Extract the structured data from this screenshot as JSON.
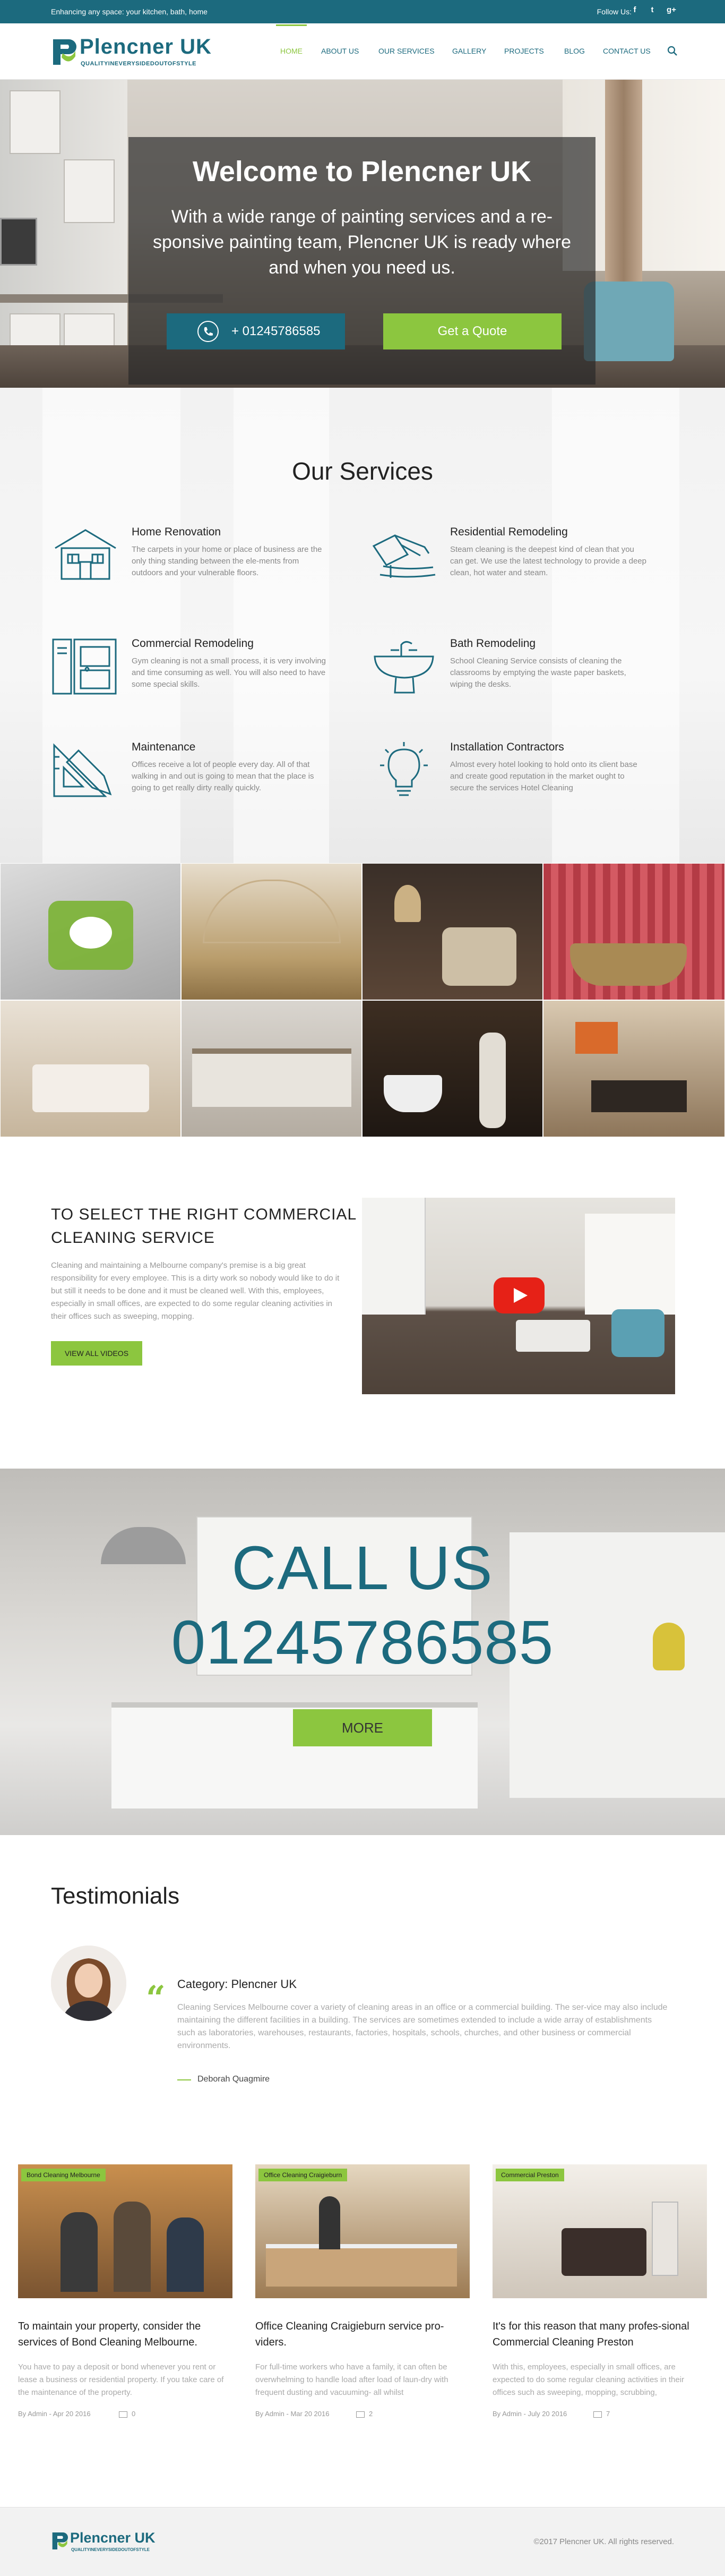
{
  "topbar": {
    "tagline": "Enhancing any space: your kitchen, bath, home",
    "follow_label": "Follow Us:",
    "social": [
      {
        "icon": "facebook-icon",
        "glyph": "f"
      },
      {
        "icon": "twitter-icon",
        "glyph": "t"
      },
      {
        "icon": "google-plus-icon",
        "glyph": "g+"
      }
    ]
  },
  "header": {
    "logo_name": "Plencner UK",
    "logo_sub": "QUALITYINEVERYSIDEDOUTOFSTYLE",
    "nav": [
      "HOME",
      "ABOUT US",
      "OUR SERVICES",
      "GALLERY",
      "PROJECTS",
      "BLOG",
      "CONTACT US"
    ],
    "active_nav": "HOME"
  },
  "hero": {
    "title": "Welcome to Plencner UK",
    "text": "With a wide range of painting services and a re-sponsive painting team, Plencner UK is ready where and when you need us.",
    "phone_button": "+ 01245786585",
    "quote_button": "Get a Quote"
  },
  "services": {
    "title": "Our Services",
    "items": [
      {
        "title": "Home Renovation",
        "icon": "house-icon",
        "desc": "The carpets in your home or place of business are the only thing standing between the ele-ments from outdoors and your vulnerable floors."
      },
      {
        "title": "Residential Remodeling",
        "icon": "paint-roller-icon",
        "desc": "Steam cleaning is the deepest kind of clean that you can get. We use the latest technology to provide a deep clean, hot water and steam."
      },
      {
        "title": "Commercial Remodeling",
        "icon": "door-icon",
        "desc": "Gym cleaning is not a small process, it is very involving and time consuming as well. You will also need to have some special skills."
      },
      {
        "title": "Bath Remodeling",
        "icon": "sink-icon",
        "desc": "School Cleaning Service consists of cleaning the classrooms by emptying the waste paper baskets, wiping the desks."
      },
      {
        "title": "Maintenance",
        "icon": "ruler-pencil-icon",
        "desc": "Offices receive a lot of people every day. All of that walking in and out is going to mean that the place is going to get really dirty really quickly."
      },
      {
        "title": "Installation Contractors",
        "icon": "light-bulb-icon",
        "desc": "Almost every hotel looking to hold onto its client base and create good reputation in the market ought to secure the services  Hotel Cleaning"
      }
    ]
  },
  "gallery": {
    "tiles": [
      {
        "name": "green-chairs-table"
      },
      {
        "name": "atrium-interior"
      },
      {
        "name": "classic-armchair-lamp"
      },
      {
        "name": "bathtub-red-wall"
      },
      {
        "name": "white-dining-room"
      },
      {
        "name": "kitchen-interior"
      },
      {
        "name": "bathroom-statue"
      },
      {
        "name": "modern-living-room"
      }
    ]
  },
  "video_section": {
    "title": "TO SELECT THE RIGHT COMMERCIAL CLEANING SERVICE",
    "text": "Cleaning and maintaining a Melbourne company's premise is a big great responsibility for every employee. This is a dirty work so nobody would like to do it but still it needs to be done and it must be cleaned well. With this, employees, especially in small offices, are expected to do some regular cleaning activities in their offices such as sweeping, mopping.",
    "button": "VIEW ALL VIDEOS"
  },
  "call_section": {
    "title": "CALL US",
    "number": "01245786585",
    "button": "MORE"
  },
  "testimonials": {
    "title": "Testimonials",
    "category": "Category: Plencner UK",
    "text": "Cleaning Services Melbourne cover a variety of cleaning areas in an office or a commercial building. The ser-vice may also include maintaining the different facilities in a building. The services are sometimes extended to include a wide array of establishments such as laboratories, warehouses, restaurants, factories, hospitals, schools, churches, and other business or commercial environments.",
    "author": "Deborah Quagmire"
  },
  "blog": {
    "posts": [
      {
        "badge": "Bond Cleaning Melbourne",
        "title": "To maintain your property, consider the services of Bond Cleaning Melbourne.",
        "excerpt": "You have to pay a deposit or bond whenever you rent or lease a business or residential property. If you take care of the maintenance of the property.",
        "meta": "By Admin - Apr 20 2016",
        "comments": "0"
      },
      {
        "badge": "Office Cleaning Craigieburn",
        "title": "Office Cleaning Craigieburn service pro-viders.",
        "excerpt": "For full-time workers who have a family, it can often be overwhelming to handle load after load of laun-dry with frequent dusting and vacuuming- all whilst",
        "meta": "By Admin - Mar 20 2016",
        "comments": "2"
      },
      {
        "badge": "Commercial Preston",
        "title": "It's for this reason that many profes-sional Commercial Cleaning Preston",
        "excerpt": "With this, employees, especially in small offices, are expected to do some regular cleaning activities in their offices such as sweeping, mopping, scrubbing,",
        "meta": "By Admin - July 20 2016",
        "comments": "7"
      }
    ]
  },
  "footer": {
    "logo_name": "Plencner UK",
    "logo_sub": "QUALITYINEVERYSIDEDOUTOFSTYLE",
    "copyright": "©2017 Plencner UK. All rights reserved."
  },
  "colors": {
    "primary": "#1c6a7e",
    "accent": "#8cc63f"
  }
}
